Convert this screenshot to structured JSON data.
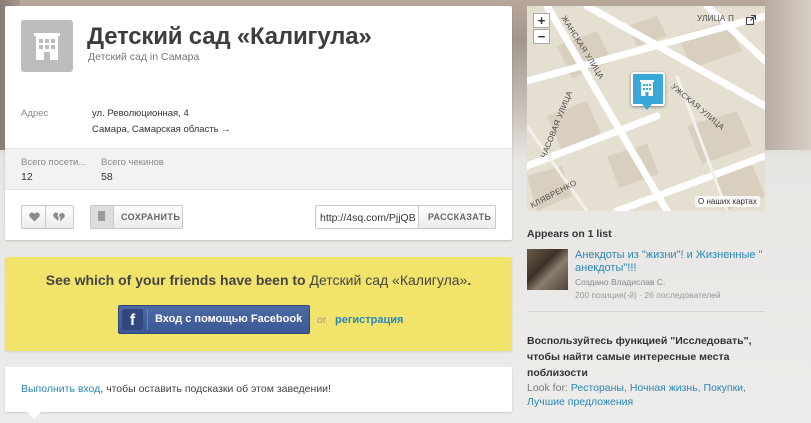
{
  "venue": {
    "title": "Детский сад «Калигула»",
    "subtitle": "Детский сад in Самара",
    "address_label": "Адрес",
    "address_line1": "ул. Революционная, 4",
    "address_line2": "Самара, Самарская область →"
  },
  "stats": {
    "visitors_label": "Всего посети...",
    "visitors_value": "12",
    "checkins_label": "Всего чекинов",
    "checkins_value": "58"
  },
  "actions": {
    "save_label": "СОХРАНИТЬ",
    "share_url": "http://4sq.com/PjjQB",
    "share_label": "РАССКАЗАТЬ"
  },
  "friends": {
    "prompt_prefix": "See which of your friends have been to ",
    "venue_name": "Детский сад «Калигула»",
    "prompt_suffix": ".",
    "facebook_button": "Вход с помощью Facebook",
    "facebook_glyph": "f",
    "or_text": "or",
    "register_link": "регистрация"
  },
  "tips": {
    "login_link": "Выполнить вход",
    "rest": ", чтобы оставить подсказки об этом заведении!"
  },
  "map": {
    "zoom_in": "+",
    "zoom_out": "−",
    "street_top": "УЛИЦА П",
    "street_chasovaya": "ЧАСОВАЯ УЛИЦА",
    "street_zhanskaya": "ЖАНСКАЯ УЛИЦА",
    "street_uzhskaya": "УЖСКАЯ УЛИЦА",
    "street_bottom": "КЛЯВРЕНКО",
    "about_maps": "О наших картах"
  },
  "sidebar": {
    "appears_title": "Appears on 1 list",
    "list_title": "Анекдоты из \"жизни\"! и Жизненные \" анекдоты\"!!!",
    "list_author": "Создано Владислав С.",
    "list_meta": "200 позиция(-й) · 26 последователей",
    "explore_text": "Воспользуйтесь функцией \"Исследовать\", чтобы найти самые интересные места поблизости",
    "lookfor_label": "Look for:",
    "lookfor_links": [
      "Рестораны",
      "Ночная жизнь",
      "Покупки",
      "Лучшие предложения"
    ]
  },
  "colors": {
    "accent_blue": "#2a87b8",
    "banner_yellow": "#f2e36b",
    "facebook_blue": "#3b5998",
    "pin_blue": "#3aa7d9"
  },
  "icons": {
    "venue": "building-icon",
    "like": "heart-icon",
    "dislike": "broken-heart-icon",
    "save": "bookmark-icon",
    "facebook": "facebook-icon",
    "map_pin": "map-pin-icon",
    "expand": "expand-icon"
  }
}
